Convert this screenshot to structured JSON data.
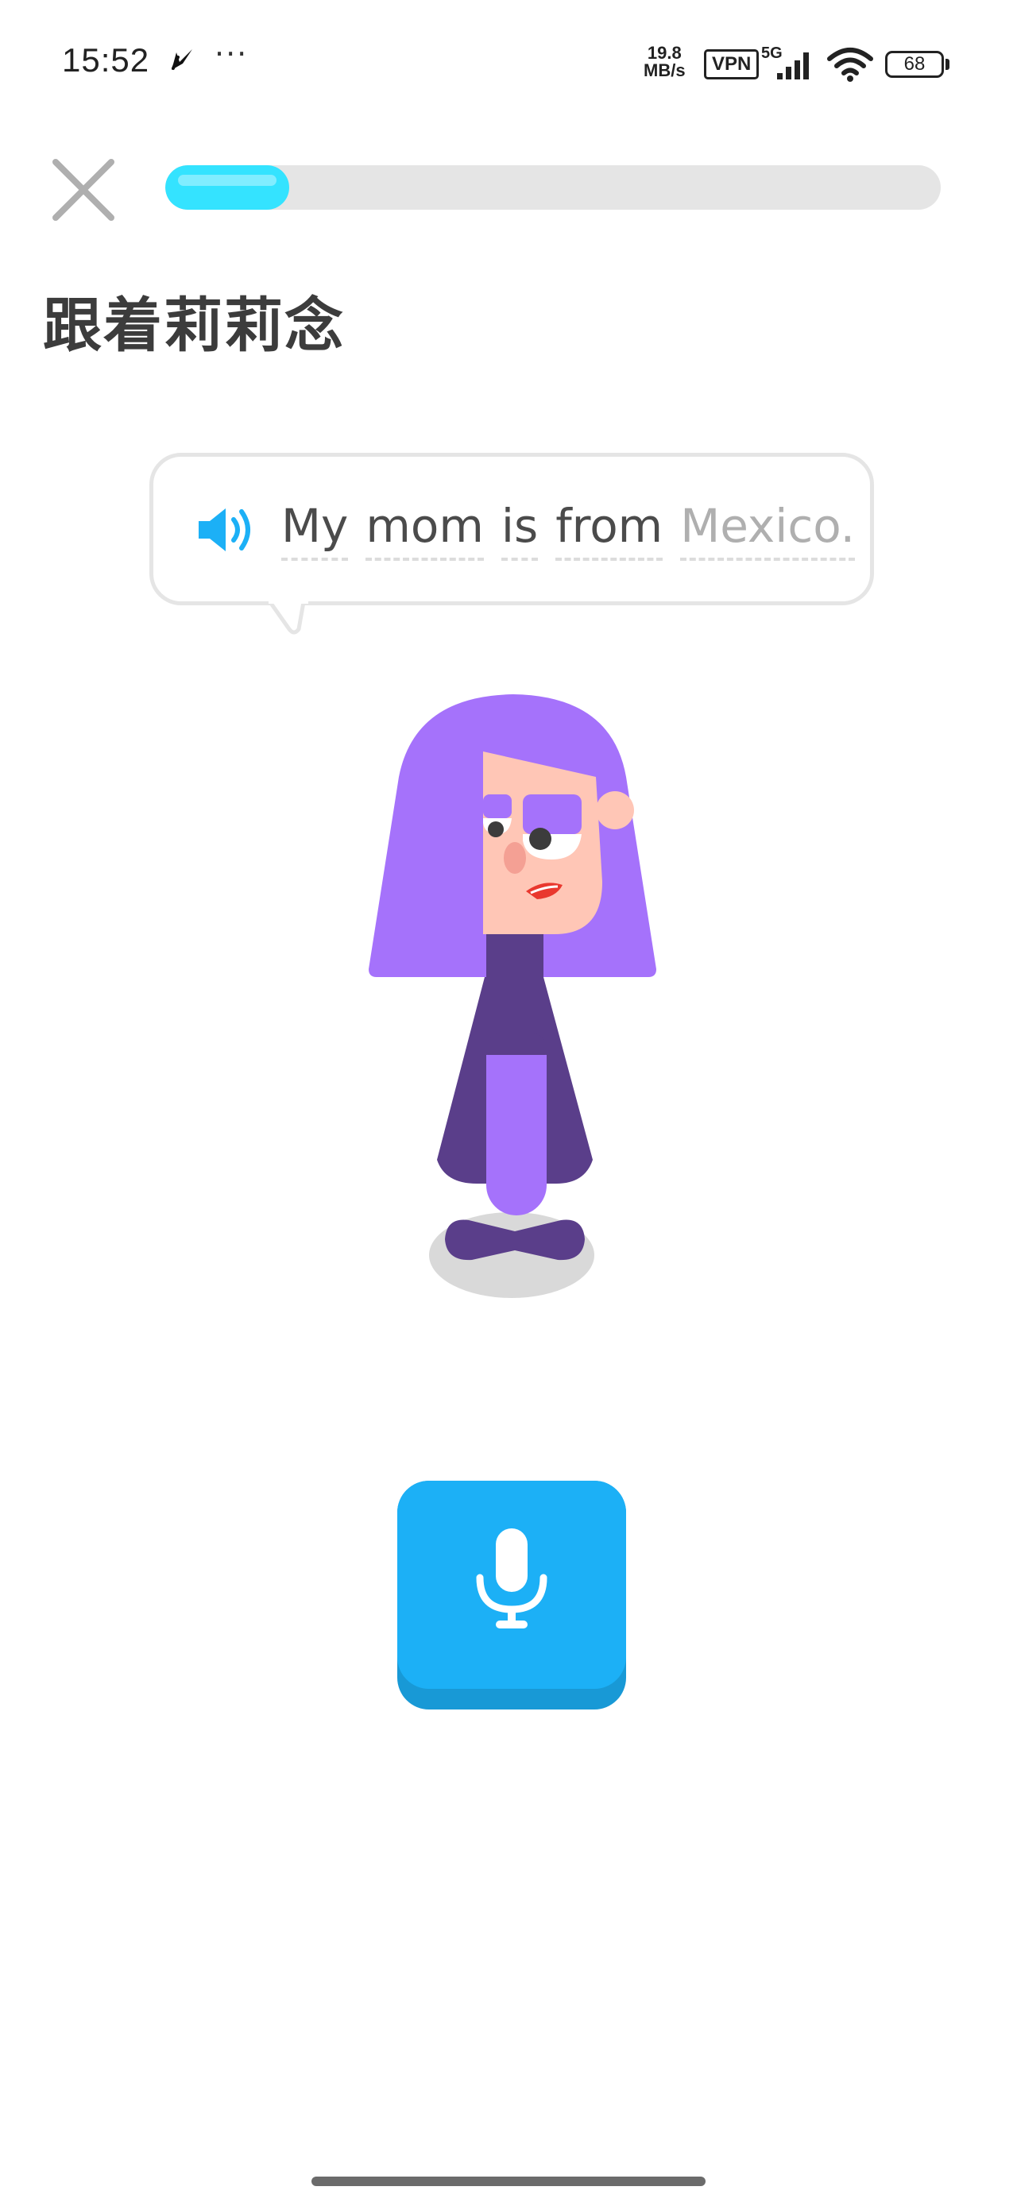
{
  "status_bar": {
    "time": "15:52",
    "more": "···",
    "network_speed_value": "19.8",
    "network_speed_unit": "MB/s",
    "vpn": "VPN",
    "network_type": "5G",
    "battery": "68"
  },
  "lesson": {
    "progress": 0.16,
    "title": "跟着莉莉念",
    "sentence": [
      {
        "text": "My",
        "state": "spoken"
      },
      {
        "text": "mom",
        "state": "spoken"
      },
      {
        "text": "is",
        "state": "spoken"
      },
      {
        "text": "from",
        "state": "spoken"
      },
      {
        "text": "Mexico.",
        "state": "pending"
      }
    ]
  },
  "colors": {
    "progress_fill": "#34e3ff",
    "progress_track": "#e5e5e5",
    "speaker_blue": "#1cb0f6",
    "mic_button": "#1cb0f6",
    "mic_button_shadow": "#1899d6",
    "hair": "#a572fb",
    "dress": "#5a3e8a",
    "skin": "#ffc6b6",
    "spoken_text": "#4b4b4b",
    "pending_text": "#afafaf"
  },
  "icons": {
    "close": "close-icon",
    "speaker": "speaker-icon",
    "microphone": "microphone-icon",
    "character": "lily-character"
  }
}
